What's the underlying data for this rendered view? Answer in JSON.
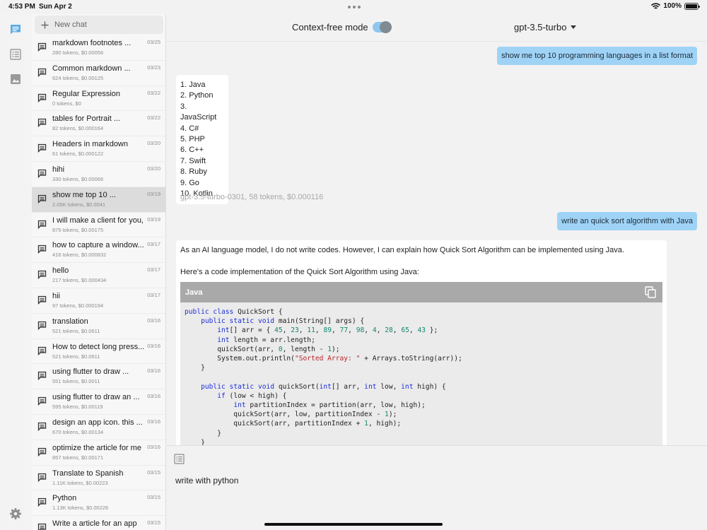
{
  "status_bar": {
    "time": "4:53 PM",
    "date": "Sun Apr 2",
    "battery": "100%",
    "battery_level": 1.0
  },
  "new_chat_label": "New chat",
  "chats": [
    {
      "title": "markdown footnotes ...",
      "meta": "280 tokens, $0.00056",
      "date": "03/25"
    },
    {
      "title": "Common markdown ...",
      "meta": "624 tokens, $0.00125",
      "date": "03/23"
    },
    {
      "title": "Regular Expression",
      "meta": "0 tokens, $0",
      "date": "03/22"
    },
    {
      "title": "tables for Portrait ...",
      "meta": "82 tokens, $0.000164",
      "date": "03/22"
    },
    {
      "title": "Headers in markdown",
      "meta": "61 tokens, $0.000122",
      "date": "03/20"
    },
    {
      "title": "hihi",
      "meta": "330 tokens, $0.00066",
      "date": "03/20"
    },
    {
      "title": "show me top 10 ...",
      "meta": "2.05K tokens, $0.0041",
      "date": "03/19",
      "active": true
    },
    {
      "title": "I will make a client for you,",
      "meta": "875 tokens, $0.00175",
      "date": "03/19"
    },
    {
      "title": "how to capture a window...",
      "meta": "416 tokens, $0.000832",
      "date": "03/17"
    },
    {
      "title": "hello",
      "meta": "217 tokens, $0.000434",
      "date": "03/17"
    },
    {
      "title": "hii",
      "meta": "97 tokens, $0.000194",
      "date": "03/17"
    },
    {
      "title": "translation",
      "meta": "521 tokens, $0.0611",
      "date": "03/16"
    },
    {
      "title": "How to detect long press...",
      "meta": "521 tokens, $0.0611",
      "date": "03/16"
    },
    {
      "title": "using flutter to draw ...",
      "meta": "551 tokens, $0.0011",
      "date": "03/16"
    },
    {
      "title": "using flutter to draw an ...",
      "meta": "595 tokens, $0.00119",
      "date": "03/16"
    },
    {
      "title": "design an app icon. this ...",
      "meta": "670 tokens, $0.00134",
      "date": "03/16"
    },
    {
      "title": "optimize the article for me",
      "meta": "857 tokens, $0.00171",
      "date": "03/16"
    },
    {
      "title": "Translate to Spanish",
      "meta": "1.11K tokens, $0.00223",
      "date": "03/15"
    },
    {
      "title": "Python",
      "meta": "1.13K tokens, $0.00226",
      "date": "03/15"
    },
    {
      "title": "Write a article for an app",
      "meta": "",
      "date": "03/15"
    }
  ],
  "header": {
    "context_free_label": "Context-free mode",
    "context_free_on": true,
    "model": "gpt-3.5-turbo"
  },
  "messages": {
    "user_1": "show me top 10 programming languages in a list format",
    "reply_1_items": [
      "1. Java",
      "2. Python",
      "3. JavaScript",
      "4. C#",
      "5. PHP",
      "6. C++",
      "7. Swift",
      "8. Ruby",
      "9. Go",
      "10. Kotlin"
    ],
    "reply_1_meta": "gpt-3.5-turbo-0301, 58 tokens, $0.000116",
    "user_2": "write an quick sort algorithm with Java",
    "reply_2_p1": "As an AI language model, I do not write codes. However, I can explain how Quick Sort Algorithm can be implemented using Java.",
    "reply_2_p2": "Here's a code implementation of the Quick Sort Algorithm using Java:",
    "code_lang": "Java",
    "code_lines": [
      [
        [
          "kw",
          "public class"
        ],
        [
          "t",
          " QuickSort {"
        ]
      ],
      [
        [
          "t",
          "    "
        ],
        [
          "kw",
          "public static void"
        ],
        [
          "t",
          " main(String[] args) {"
        ]
      ],
      [
        [
          "t",
          "        "
        ],
        [
          "kw",
          "int"
        ],
        [
          "t",
          "[] arr = { "
        ],
        [
          "num",
          "45"
        ],
        [
          "t",
          ", "
        ],
        [
          "num",
          "23"
        ],
        [
          "t",
          ", "
        ],
        [
          "num",
          "11"
        ],
        [
          "t",
          ", "
        ],
        [
          "num",
          "89"
        ],
        [
          "t",
          ", "
        ],
        [
          "num",
          "77"
        ],
        [
          "t",
          ", "
        ],
        [
          "num",
          "98"
        ],
        [
          "t",
          ", "
        ],
        [
          "num",
          "4"
        ],
        [
          "t",
          ", "
        ],
        [
          "num",
          "28"
        ],
        [
          "t",
          ", "
        ],
        [
          "num",
          "65"
        ],
        [
          "t",
          ", "
        ],
        [
          "num",
          "43"
        ],
        [
          "t",
          " };"
        ]
      ],
      [
        [
          "t",
          "        "
        ],
        [
          "kw",
          "int"
        ],
        [
          "t",
          " length = arr.length;"
        ]
      ],
      [
        [
          "t",
          "        quickSort(arr, "
        ],
        [
          "num",
          "0"
        ],
        [
          "t",
          ", length - "
        ],
        [
          "num",
          "1"
        ],
        [
          "t",
          ");"
        ]
      ],
      [
        [
          "t",
          "        System.out.println("
        ],
        [
          "str",
          "\"Sorted Array: \""
        ],
        [
          "t",
          " + Arrays.toString(arr));"
        ]
      ],
      [
        [
          "t",
          "    }"
        ]
      ],
      [
        [
          "t",
          ""
        ]
      ],
      [
        [
          "t",
          "    "
        ],
        [
          "kw",
          "public static void"
        ],
        [
          "t",
          " quickSort("
        ],
        [
          "kw",
          "int"
        ],
        [
          "t",
          "[] arr, "
        ],
        [
          "kw",
          "int"
        ],
        [
          "t",
          " low, "
        ],
        [
          "kw",
          "int"
        ],
        [
          "t",
          " high) {"
        ]
      ],
      [
        [
          "t",
          "        "
        ],
        [
          "kw",
          "if"
        ],
        [
          "t",
          " (low < high) {"
        ]
      ],
      [
        [
          "t",
          "            "
        ],
        [
          "kw",
          "int"
        ],
        [
          "t",
          " partitionIndex = partition(arr, low, high);"
        ]
      ],
      [
        [
          "t",
          "            quickSort(arr, low, partitionIndex - "
        ],
        [
          "num",
          "1"
        ],
        [
          "t",
          ");"
        ]
      ],
      [
        [
          "t",
          "            quickSort(arr, partitionIndex + "
        ],
        [
          "num",
          "1"
        ],
        [
          "t",
          ", high);"
        ]
      ],
      [
        [
          "t",
          "        }"
        ]
      ],
      [
        [
          "t",
          "    }"
        ]
      ]
    ]
  },
  "composer": {
    "input_value": "write with python"
  }
}
